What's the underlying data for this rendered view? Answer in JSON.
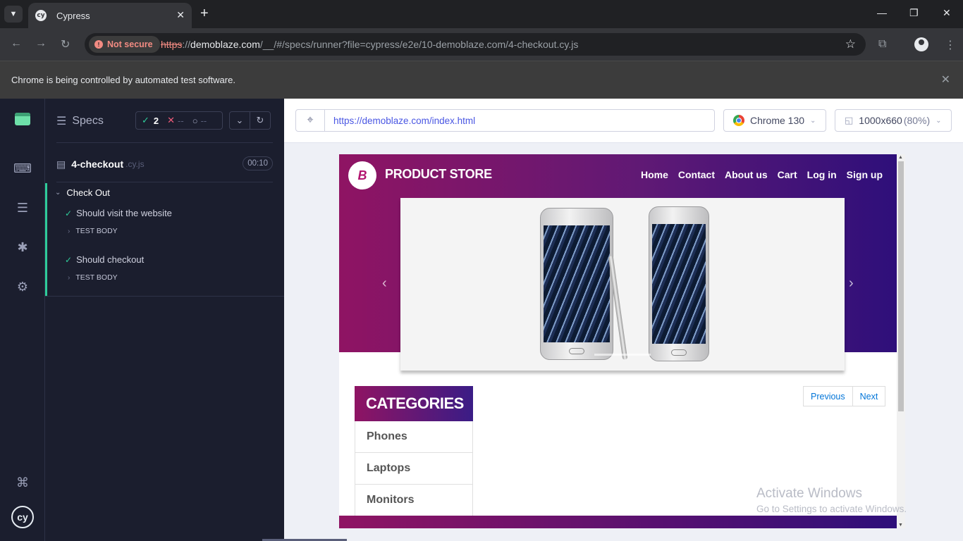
{
  "browser": {
    "tab_title": "Cypress",
    "tab_icon": "cy",
    "not_secure": "Not secure",
    "url_scheme": "https",
    "url_sep": "://",
    "url_host": "demoblaze.com",
    "url_path": "/__/#/specs/runner?file=cypress/e2e/10-demoblaze.com/4-checkout.cy.js",
    "infobar": "Chrome is being controlled by automated test software.",
    "accent": "#f28b82"
  },
  "reporter": {
    "specs_label": "Specs",
    "passed": "2",
    "failed": "--",
    "pending": "--",
    "file_name": "4-checkout",
    "file_ext": ".cy.js",
    "duration": "00:10",
    "suite_title": "Check Out",
    "tests": [
      {
        "title": "Should visit the website",
        "body": "TEST BODY"
      },
      {
        "title": "Should checkout",
        "body": "TEST BODY"
      }
    ],
    "pass_color": "#2ecc9a",
    "fail_color": "#f05b7a"
  },
  "aut": {
    "url": "https://demoblaze.com/index.html",
    "browser": "Chrome 130",
    "viewport": "1000x660",
    "viewport_scale": "(80%)"
  },
  "site": {
    "brand_letter": "B",
    "brand": "PRODUCT STORE",
    "nav": [
      "Home",
      "Contact",
      "About us",
      "Cart",
      "Log in",
      "Sign up"
    ],
    "categories_title": "CATEGORIES",
    "categories": [
      "Phones",
      "Laptops",
      "Monitors"
    ],
    "pager": {
      "previous": "Previous",
      "next": "Next"
    }
  },
  "watermark": {
    "line1": "Activate Windows",
    "line2": "Go to Settings to activate Windows."
  }
}
